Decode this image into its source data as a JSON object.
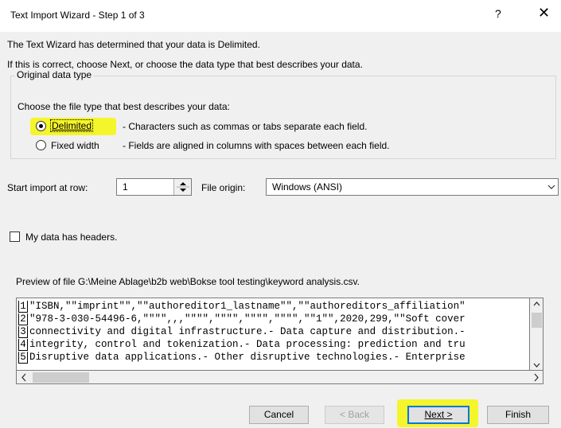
{
  "window": {
    "title": "Text Import Wizard - Step 1 of 3",
    "help": "?",
    "close": "✕"
  },
  "intro": {
    "line1": "The Text Wizard has determined that your data is Delimited.",
    "line2": "If this is correct, choose Next, or choose the data type that best describes your data."
  },
  "data_type": {
    "legend": "Original data type",
    "prompt": "Choose the file type that best describes your data:",
    "options": [
      {
        "label": "Delimited",
        "desc": "- Characters such as commas or tabs separate each field.",
        "selected": true
      },
      {
        "label": "Fixed width",
        "desc": "- Fields are aligned in columns with spaces between each field.",
        "selected": false
      }
    ]
  },
  "start_row": {
    "label": "Start import at row:",
    "value": "1"
  },
  "file_origin": {
    "label": "File origin:",
    "value": "Windows (ANSI)"
  },
  "headers_checkbox": {
    "label": "My data has headers.",
    "checked": false
  },
  "preview": {
    "label": "Preview of file G:\\Meine Ablage\\b2b web\\Bokse tool testing\\keyword analysis.csv.",
    "lines": [
      {
        "num": "1",
        "text": "\"ISBN,\"\"imprint\"\",\"\"authoreditor1_lastname\"\",\"\"authoreditors_affiliation\""
      },
      {
        "num": "2",
        "text": "\"978-3-030-54496-6,\"\"\"\",,,\"\"\"\",\"\"\"\",\"\"\"\",\"\"\"\",\"\"1\"\",2020,299,\"\"Soft cover"
      },
      {
        "num": "3",
        "text": "connectivity and digital infrastructure.- Data capture and distribution.-"
      },
      {
        "num": "4",
        "text": "integrity, control and tokenization.- Data processing: prediction and tru"
      },
      {
        "num": "5",
        "text": "Disruptive data applications.- Other disruptive technologies.- Enterprise"
      }
    ]
  },
  "buttons": {
    "cancel": "Cancel",
    "back": "< Back",
    "next": "Next >",
    "finish": "Finish"
  },
  "colors": {
    "highlight": "#f7f62a",
    "focus_border": "#0078d7"
  }
}
